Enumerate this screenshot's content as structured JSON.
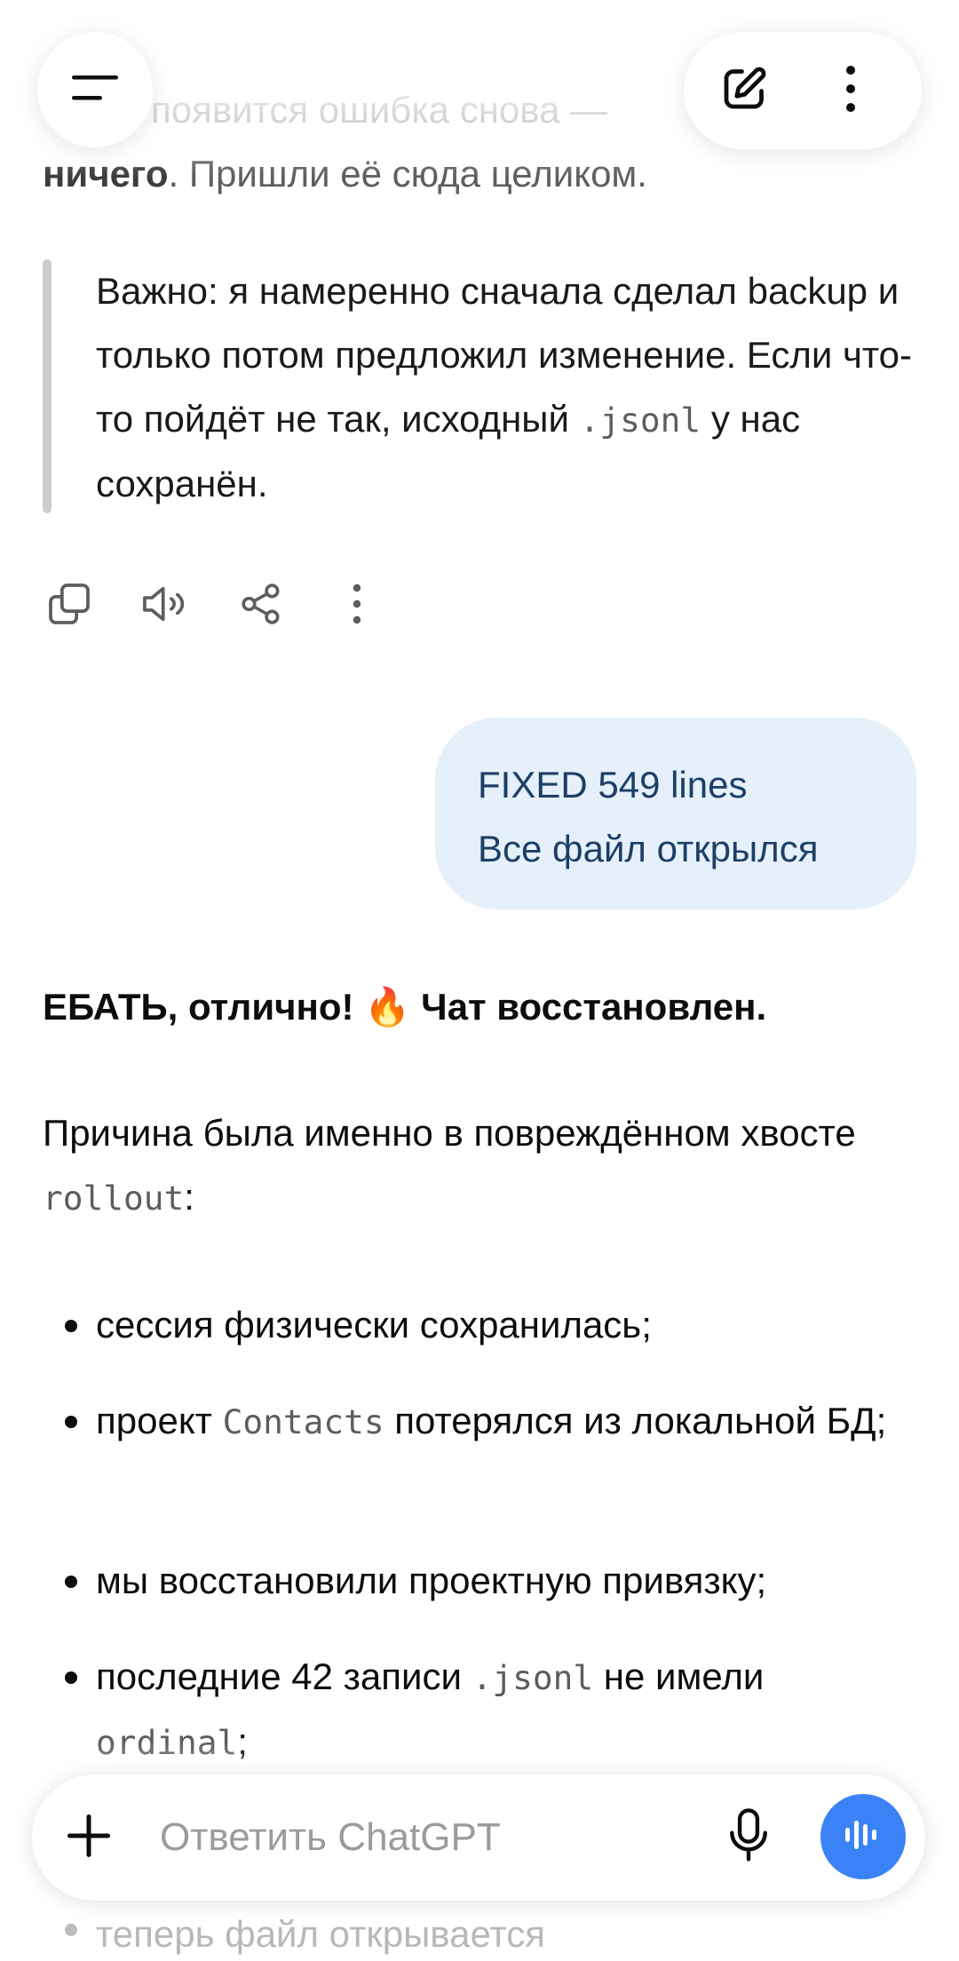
{
  "top_fragment": {
    "line1": "появится ошибка снова —",
    "line2_bold": "ничего",
    "line2_rest": ". Пришли её сюда целиком."
  },
  "blockquote": {
    "before_code": "Важно: я намеренно сначала сделал backup и только потом предложил изменение. Если что-то пойдёт не так, исходный ",
    "code": ".jsonl",
    "after_code": " у нас сохранён."
  },
  "message_actions": [
    {
      "icon": "copy-icon"
    },
    {
      "icon": "read-aloud-icon"
    },
    {
      "icon": "share-icon"
    },
    {
      "icon": "more-vertical-icon"
    }
  ],
  "user_message": {
    "line1": "FIXED 549 lines",
    "line2": "Все файл открылся"
  },
  "assistant": {
    "heading_part1": "ЕБАТЬ, отлично! ",
    "heading_emoji": "🔥",
    "heading_part2": " Чат восстановлен.",
    "cause_text": "Причина была именно в повреждённом хвосте ",
    "cause_code": "rollout",
    "cause_end": ":",
    "bullets": [
      {
        "text_before": "сессия физически сохранилась;"
      },
      {
        "text_before": "проект ",
        "code": "Contacts",
        "text_after": " потерялся из локальной БД;"
      },
      {
        "text_before": "мы восстановили проектную привязку;"
      },
      {
        "text_before": "последние 42 записи ",
        "code": ".jsonl",
        "text_after": " не имели ",
        "code2": "ordinal",
        "text_after2": ";"
      }
    ],
    "partial_bullet": "теперь файл открывается"
  },
  "composer": {
    "placeholder": "Ответить ChatGPT"
  },
  "colors": {
    "user_bubble_bg": "#e5f0fb",
    "user_bubble_text": "#1d3f66",
    "voice_button": "#3b82f6"
  }
}
